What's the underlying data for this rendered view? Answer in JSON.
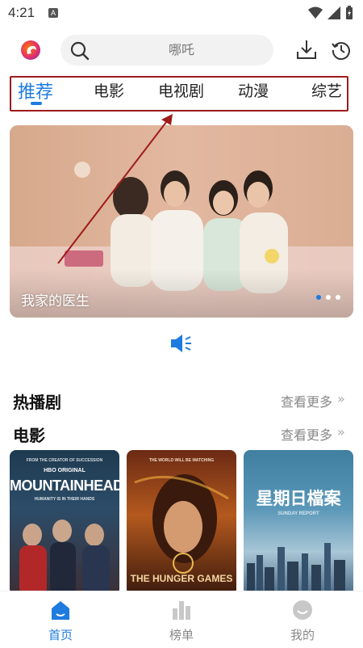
{
  "status_bar": {
    "time": "4:21",
    "notification_glyph": "A"
  },
  "header": {
    "search_placeholder": "哪吒"
  },
  "tabs": [
    {
      "label": "推荐",
      "active": true
    },
    {
      "label": "电影"
    },
    {
      "label": "电视剧"
    },
    {
      "label": "动漫"
    },
    {
      "label": "综艺"
    }
  ],
  "banner": {
    "title": "我家的医生",
    "slide_count": 3,
    "active_slide": 1
  },
  "sections": {
    "hot_series": {
      "title": "热播剧",
      "more": "查看更多"
    },
    "movies": {
      "title": "电影",
      "more": "查看更多",
      "more_chevron": "»"
    }
  },
  "posters": [
    {
      "top_text": "FROM THE CREATOR OF SUCCESSION",
      "brand": "HBO ORIGINAL",
      "title": "MOUNTAINHEAD",
      "tagline": "HUMANITY IS IN THEIR HANDS"
    },
    {
      "top_text": "THE WORLD WILL BE WATCHING",
      "title": "THE HUNGER GAMES"
    },
    {
      "title": "星期日檔案",
      "subtitle": "SUNDAY REPORT"
    }
  ],
  "bottom_nav": [
    {
      "label": "首页",
      "active": true
    },
    {
      "label": "榜单"
    },
    {
      "label": "我的"
    }
  ],
  "colors": {
    "accent": "#1e7be0",
    "annotation": "#9e1b1b"
  }
}
